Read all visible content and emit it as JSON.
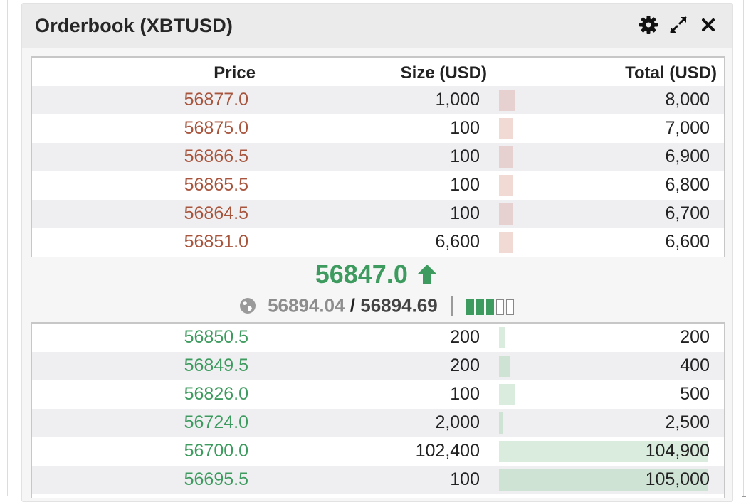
{
  "panel": {
    "title": "Orderbook (XBTUSD)",
    "icons": [
      "gear-icon",
      "expand-icon",
      "close-icon"
    ]
  },
  "columns": {
    "price": "Price",
    "size": "Size (USD)",
    "total": "Total (USD)"
  },
  "asks": [
    {
      "price": "56877.0",
      "size": "1,000",
      "total": "8,000",
      "depth_fraction": 0.076
    },
    {
      "price": "56875.0",
      "size": "100",
      "total": "7,000",
      "depth_fraction": 0.066
    },
    {
      "price": "56866.5",
      "size": "100",
      "total": "6,900",
      "depth_fraction": 0.066
    },
    {
      "price": "56865.5",
      "size": "100",
      "total": "6,800",
      "depth_fraction": 0.066
    },
    {
      "price": "56864.5",
      "size": "100",
      "total": "6,700",
      "depth_fraction": 0.066
    },
    {
      "price": "56851.0",
      "size": "6,600",
      "total": "6,600",
      "depth_fraction": 0.066
    }
  ],
  "last_price": {
    "value": "56847.0",
    "direction": "up",
    "icon": "arrow-up-icon"
  },
  "index_line": {
    "icon": "globe-icon",
    "mark_price": "56894.04",
    "separator": "/",
    "index_price": "56894.69",
    "liquidity_level": 3,
    "liquidity_max": 5
  },
  "bids": [
    {
      "price": "56850.5",
      "size": "200",
      "total": "200",
      "depth_fraction": 0.03
    },
    {
      "price": "56849.5",
      "size": "200",
      "total": "400",
      "depth_fraction": 0.055
    },
    {
      "price": "56826.0",
      "size": "100",
      "total": "500",
      "depth_fraction": 0.075
    },
    {
      "price": "56724.0",
      "size": "2,000",
      "total": "2,500",
      "depth_fraction": 0.02
    },
    {
      "price": "56700.0",
      "size": "102,400",
      "total": "104,900",
      "depth_fraction": 1.0
    },
    {
      "price": "56695.5",
      "size": "100",
      "total": "105,000",
      "depth_fraction": 1.0
    }
  ],
  "colors": {
    "ask_price": "#a8553d",
    "bid_price": "#3e9b5f",
    "ask_depth": "#f1d9d4",
    "bid_depth": "#d9ecdd"
  }
}
